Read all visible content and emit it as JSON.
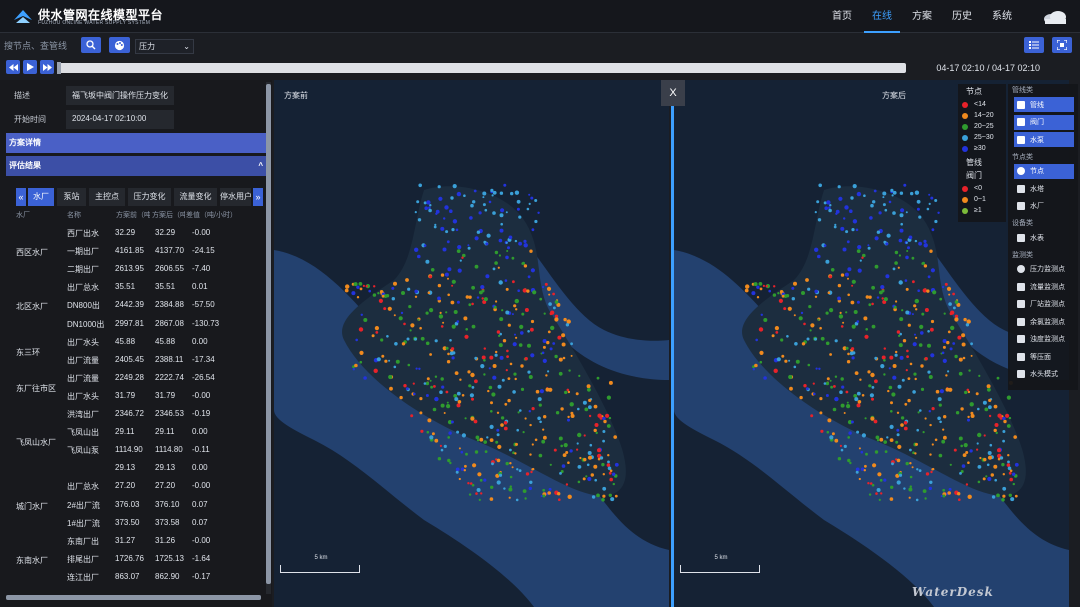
{
  "header": {
    "title": "供水管网在线模型平台",
    "subtitle": "FUZHOU ONLINE WATER SUPPLY SYSTEM",
    "nav": [
      "首页",
      "在线",
      "方案",
      "历史",
      "系统"
    ],
    "active_nav": "在线"
  },
  "toolbar": {
    "search_placeholder": "搜节点、查管线",
    "select_value": "压力"
  },
  "playback": {
    "time_range": "04-17 02:10 / 04-17 02:10",
    "progress": 0.0
  },
  "left": {
    "desc_label": "描述",
    "desc_value": "福飞坂中阀门操作压力变化",
    "start_label": "开始时间",
    "start_value": "2024-04-17 02:10:00",
    "section1": "方案详情",
    "section2": "评估结果",
    "tabs": [
      "水厂",
      "泵站",
      "主控点",
      "压力变化",
      "流量变化",
      "停水用户"
    ],
    "active_tab": "水厂",
    "columns": [
      "水厂",
      "名称",
      "方案前（吨/小时）",
      "方案后（吨/小时）",
      "差值（吨/小时）"
    ],
    "groups": [
      {
        "name": "西区水厂",
        "rows": [
          {
            "name": "西厂出水",
            "before": "32.29",
            "after": "32.29",
            "diff": "-0.00"
          },
          {
            "name": "一期出厂",
            "before": "4161.85",
            "after": "4137.70",
            "diff": "-24.15"
          },
          {
            "name": "二期出厂",
            "before": "2613.95",
            "after": "2606.55",
            "diff": "-7.40"
          }
        ]
      },
      {
        "name": "北区水厂",
        "rows": [
          {
            "name": "出厂总水",
            "before": "35.51",
            "after": "35.51",
            "diff": "0.01"
          },
          {
            "name": "DN800出",
            "before": "2442.39",
            "after": "2384.88",
            "diff": "-57.50"
          },
          {
            "name": "DN1000出",
            "before": "2997.81",
            "after": "2867.08",
            "diff": "-130.73"
          }
        ]
      },
      {
        "name": "东三环",
        "rows": [
          {
            "name": "出厂水头",
            "before": "45.88",
            "after": "45.88",
            "diff": "0.00"
          },
          {
            "name": "出厂流量",
            "before": "2405.45",
            "after": "2388.11",
            "diff": "-17.34"
          }
        ]
      },
      {
        "name": "东厂往市区",
        "rows": [
          {
            "name": "出厂流量",
            "before": "2249.28",
            "after": "2222.74",
            "diff": "-26.54"
          },
          {
            "name": "出厂水头",
            "before": "31.79",
            "after": "31.79",
            "diff": "-0.00"
          }
        ]
      },
      {
        "name": "飞凤山水厂",
        "rows": [
          {
            "name": "洪湾出厂",
            "before": "2346.72",
            "after": "2346.53",
            "diff": "-0.19"
          },
          {
            "name": "飞凤山出",
            "before": "29.11",
            "after": "29.11",
            "diff": "0.00"
          },
          {
            "name": "飞凤山泵",
            "before": "1114.90",
            "after": "1114.80",
            "diff": "-0.11"
          },
          {
            "name": "",
            "before": "29.13",
            "after": "29.13",
            "diff": "0.00"
          }
        ]
      },
      {
        "name": "城门水厂",
        "rows": [
          {
            "name": "出厂总水",
            "before": "27.20",
            "after": "27.20",
            "diff": "-0.00"
          },
          {
            "name": "2#出厂流",
            "before": "376.03",
            "after": "376.10",
            "diff": "0.07"
          },
          {
            "name": "1#出厂流",
            "before": "373.50",
            "after": "373.58",
            "diff": "0.07"
          }
        ]
      },
      {
        "name": "东南水厂",
        "rows": [
          {
            "name": "东南厂出",
            "before": "31.27",
            "after": "31.26",
            "diff": "-0.00"
          },
          {
            "name": "排尾出厂",
            "before": "1726.76",
            "after": "1725.13",
            "diff": "-1.64"
          },
          {
            "name": "连江出厂",
            "before": "863.07",
            "after": "862.90",
            "diff": "-0.17"
          }
        ]
      }
    ]
  },
  "map": {
    "left_caption": "方案前",
    "right_caption": "方案后",
    "scale_label": "5 km",
    "close_label": "X"
  },
  "legend": {
    "node_title": "节点",
    "node_items": [
      {
        "label": "<14",
        "color": "#e8222a"
      },
      {
        "label": "14~20",
        "color": "#f08a1e"
      },
      {
        "label": "20~25",
        "color": "#2f9b2f"
      },
      {
        "label": "25~30",
        "color": "#3aa0d8"
      },
      {
        "label": "≥30",
        "color": "#2233dd"
      }
    ],
    "pipe_title": "管线",
    "valve_title": "阀门",
    "valve_items": [
      {
        "label": "<0",
        "color": "#e8222a"
      },
      {
        "label": "0~1",
        "color": "#f08a1e"
      },
      {
        "label": "≥1",
        "color": "#7dbb3a"
      }
    ]
  },
  "layers": {
    "groups": [
      {
        "title": "管线类",
        "items": [
          {
            "label": "管线",
            "active": true,
            "icon": "line-icon"
          },
          {
            "label": "阀门",
            "active": true,
            "icon": "valve-icon"
          },
          {
            "label": "水泵",
            "active": true,
            "icon": "pump-icon"
          }
        ]
      },
      {
        "title": "节点类",
        "items": [
          {
            "label": "节点",
            "active": true,
            "icon": "dot-icon"
          },
          {
            "label": "水塔",
            "active": false,
            "icon": "tower-icon"
          },
          {
            "label": "水厂",
            "active": false,
            "icon": "plant-icon"
          }
        ]
      },
      {
        "title": "设备类",
        "items": [
          {
            "label": "水表",
            "active": false,
            "icon": "meter-icon"
          }
        ]
      },
      {
        "title": "监测类",
        "items": [
          {
            "label": "压力监测点",
            "active": false,
            "icon": "pressure-dot-icon"
          },
          {
            "label": "流量监测点",
            "active": false,
            "icon": "flow-square-icon"
          },
          {
            "label": "厂站监测点",
            "active": false,
            "icon": "station-icon"
          },
          {
            "label": "余氯监测点",
            "active": false,
            "icon": "chlorine-square-icon"
          },
          {
            "label": "浊度监测点",
            "active": false,
            "icon": "turbidity-line-icon"
          },
          {
            "label": "等压面",
            "active": false,
            "icon": "isobar-icon"
          },
          {
            "label": "水头模式",
            "active": false,
            "icon": "head-mode-icon"
          }
        ]
      }
    ]
  },
  "watermark": "WaterDesk"
}
